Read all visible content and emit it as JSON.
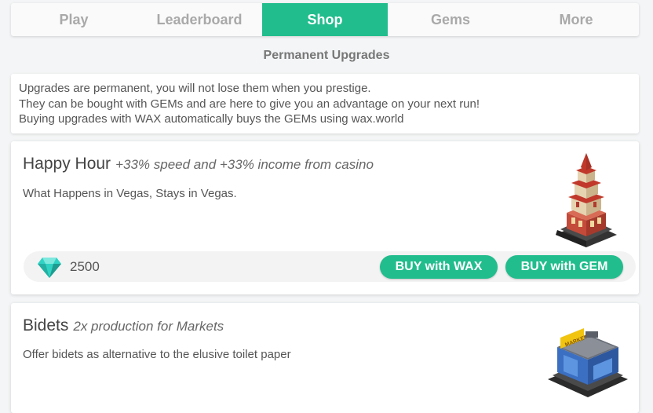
{
  "tabs": [
    {
      "label": "Play",
      "active": false
    },
    {
      "label": "Leaderboard",
      "active": false
    },
    {
      "label": "Shop",
      "active": true
    },
    {
      "label": "Gems",
      "active": false
    },
    {
      "label": "More",
      "active": false
    }
  ],
  "section_title": "Permanent Upgrades",
  "info_lines": [
    "Upgrades are permanent, you will not lose them when you prestige.",
    "They can be bought with GEMs and are here to give you an advantage on your next run!",
    "Buying upgrades with WAX automatically buys the GEMs using wax.world"
  ],
  "upgrades": [
    {
      "title": "Happy Hour",
      "subtitle": "+33% speed and +33% income from casino",
      "description": "What Happens in Vegas, Stays in Vegas.",
      "price": "2500",
      "buy_wax_label": "BUY with WAX",
      "buy_gem_label": "BUY with GEM",
      "icon": "casino-tower-icon"
    },
    {
      "title": "Bidets",
      "subtitle": "2x production for Markets",
      "description": "Offer bidets as alternative to the elusive toilet paper",
      "sign_text": "MARKET",
      "icon": "market-building-icon"
    }
  ],
  "colors": {
    "accent": "#22bd8d",
    "background": "#f3f5f6",
    "gem": "#2fd3c4"
  }
}
